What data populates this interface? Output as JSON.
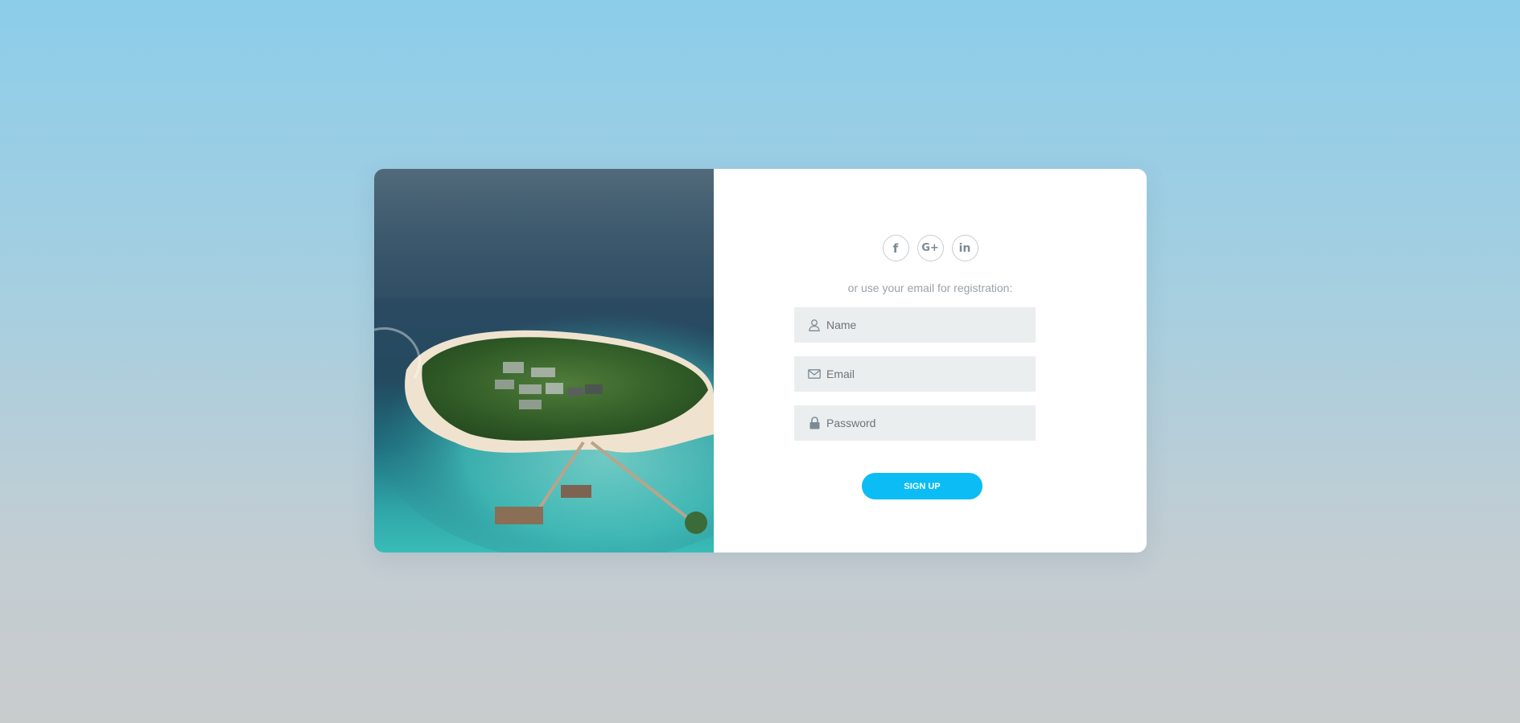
{
  "social": {
    "facebook_glyph": "f",
    "google_glyph": "G+",
    "linkedin_glyph": "in"
  },
  "form": {
    "subtitle": "or use your email for registration:",
    "name_placeholder": "Name",
    "email_placeholder": "Email",
    "password_placeholder": "Password",
    "submit_label": "SIGN UP"
  },
  "colors": {
    "accent": "#0bbcf5",
    "field_bg": "#ebeeef",
    "icon": "#7d8a94"
  },
  "icons": {
    "name": "user-icon",
    "email": "envelope-icon",
    "password": "lock-icon"
  }
}
